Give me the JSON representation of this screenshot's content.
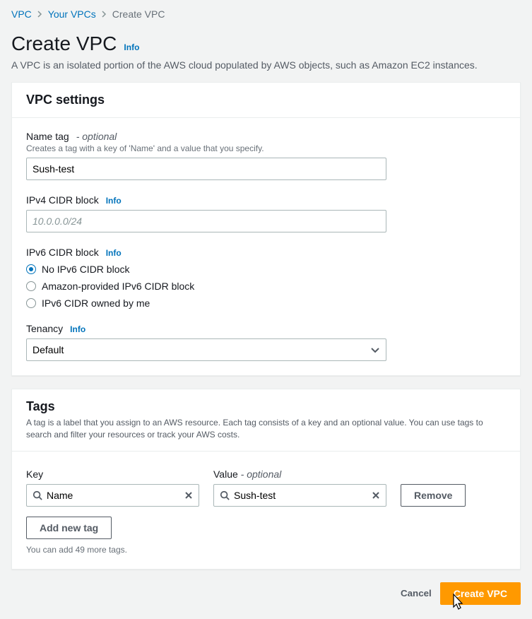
{
  "breadcrumb": {
    "items": [
      "VPC",
      "Your VPCs",
      "Create VPC"
    ]
  },
  "page": {
    "title": "Create VPC",
    "info": "Info",
    "description": "A VPC is an isolated portion of the AWS cloud populated by AWS objects, such as Amazon EC2 instances."
  },
  "vpc_settings": {
    "heading": "VPC settings",
    "name_tag_label": "Name tag",
    "optional_text": "- optional",
    "name_tag_hint": "Creates a tag with a key of 'Name' and a value that you specify.",
    "name_tag_value": "Sush-test",
    "ipv4_label": "IPv4 CIDR block",
    "ipv4_info": "Info",
    "ipv4_placeholder": "10.0.0.0/24",
    "ipv4_value": "",
    "ipv6_label": "IPv6 CIDR block",
    "ipv6_info": "Info",
    "ipv6_options": [
      "No IPv6 CIDR block",
      "Amazon-provided IPv6 CIDR block",
      "IPv6 CIDR owned by me"
    ],
    "tenancy_label": "Tenancy",
    "tenancy_info": "Info",
    "tenancy_value": "Default"
  },
  "tags": {
    "heading": "Tags",
    "description": "A tag is a label that you assign to an AWS resource. Each tag consists of a key and an optional value. You can use tags to search and filter your resources or track your AWS costs.",
    "key_label": "Key",
    "value_label": "Value",
    "value_optional": "- optional",
    "rows": [
      {
        "key": "Name",
        "value": "Sush-test"
      }
    ],
    "remove_label": "Remove",
    "add_label": "Add new tag",
    "footer": "You can add 49 more tags."
  },
  "actions": {
    "cancel": "Cancel",
    "submit": "Create VPC"
  }
}
